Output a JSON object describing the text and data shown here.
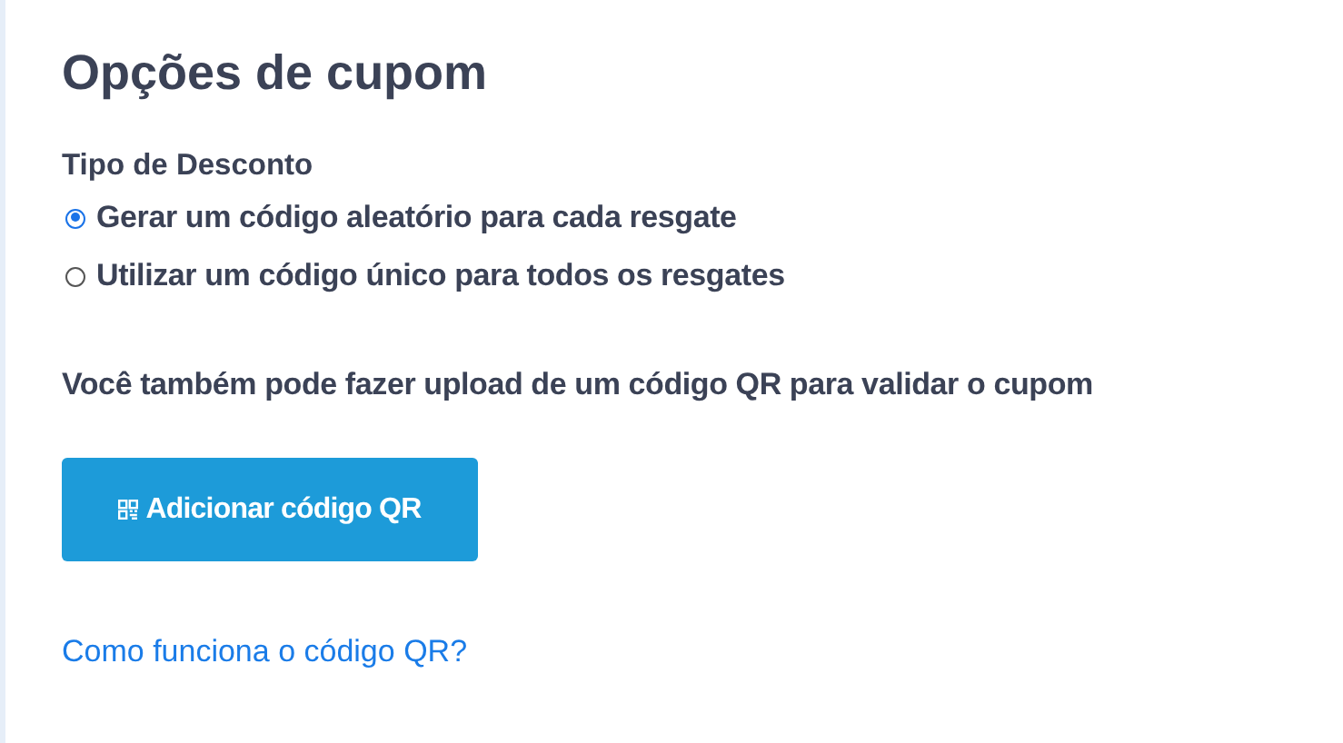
{
  "title": "Opções de cupom",
  "discount_type": {
    "label": "Tipo de Desconto",
    "options": [
      {
        "label": "Gerar um código aleatório para cada resgate",
        "selected": true
      },
      {
        "label": "Utilizar um código único para todos os resgates",
        "selected": false
      }
    ]
  },
  "upload_note": "Você também pode fazer upload de um código QR para validar o cupom",
  "add_qr_button": "Adicionar código QR",
  "help_link": "Como funciona o código QR?"
}
